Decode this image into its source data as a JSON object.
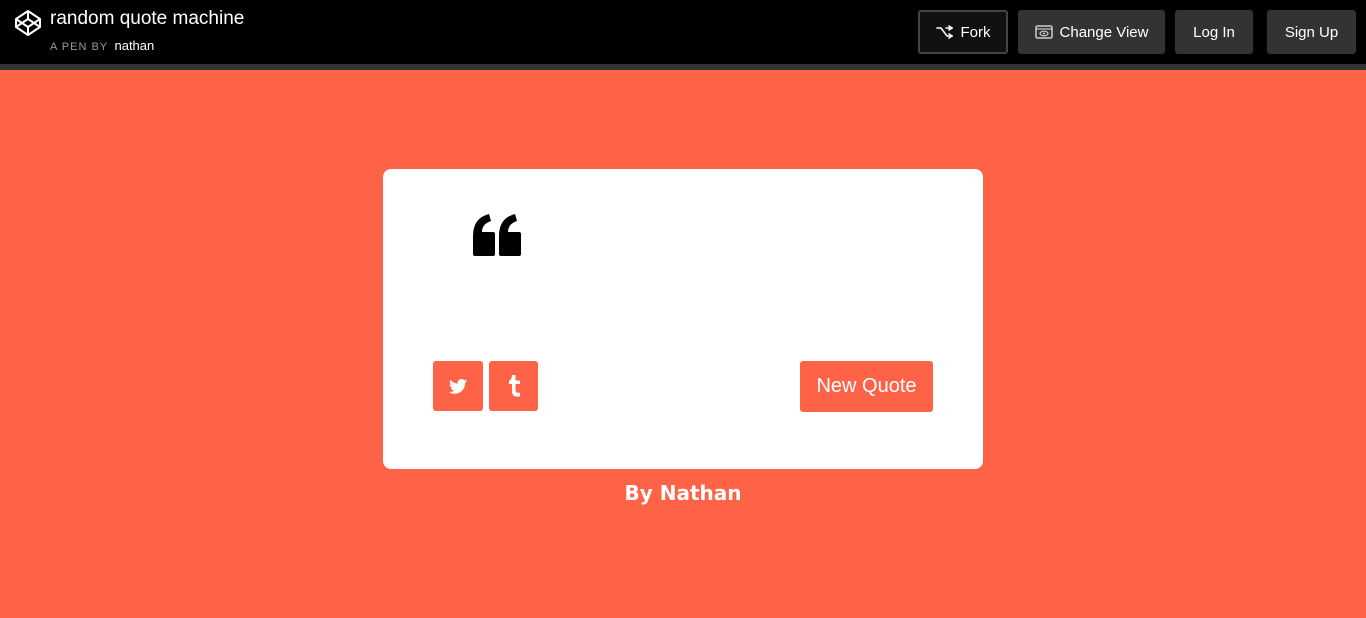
{
  "header": {
    "title": "random quote machine",
    "by_label": "A PEN BY",
    "author": "nathan",
    "buttons": {
      "fork": "Fork",
      "change_view": "Change View",
      "log_in": "Log In",
      "sign_up": "Sign Up"
    }
  },
  "card": {
    "quote_icon": "quote-left-icon",
    "social": [
      "twitter-icon",
      "tumblr-icon"
    ],
    "new_quote_label": "New Quote"
  },
  "byline": "By Nathan",
  "colors": {
    "accent": "#ff6347",
    "header_bg": "#000000",
    "button_bg": "#333333",
    "card_bg": "#ffffff"
  }
}
